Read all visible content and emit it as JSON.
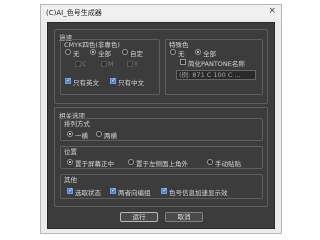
{
  "window": {
    "title": "(C)AI_色号生成器",
    "close_glyph": "×"
  },
  "filter_group": {
    "title": "過濾",
    "cmyk": {
      "title": "CMYK四色(非專色)",
      "options": [
        "无",
        "全部",
        "自定"
      ],
      "selected": "全部",
      "cmy_checks": [
        "C",
        "M",
        "Y"
      ],
      "only_chinese_label": "只有英文",
      "only_chinese_checked": true,
      "only_cn_label": "只有中文",
      "only_cn_checked": true
    },
    "spot": {
      "title": "特殊色",
      "options": [
        "无",
        "全部"
      ],
      "selected": "全部",
      "pantone_label": "简化PANTONE名称",
      "pantone_checked": false,
      "example_text": "(例: 871 C 100 C ..."
    }
  },
  "options_group": {
    "title": "相关选项",
    "sort": {
      "title": "排列方式",
      "options": [
        "一横",
        "两横"
      ],
      "selected": "一横"
    },
    "position": {
      "title": "位置",
      "options": [
        "置于屏幕正中",
        "置于左侧面上角外",
        "手动贴贴"
      ],
      "selected": "置于屏幕正中"
    },
    "other": {
      "title": "其他",
      "checks": [
        {
          "label": "选取状态",
          "checked": true
        },
        {
          "label": "两者向编组",
          "checked": true
        },
        {
          "label": "色号信息加速显示效",
          "checked": true
        }
      ]
    }
  },
  "buttons": {
    "ok": "运行",
    "cancel": "取消"
  },
  "check_glyph": "✓"
}
